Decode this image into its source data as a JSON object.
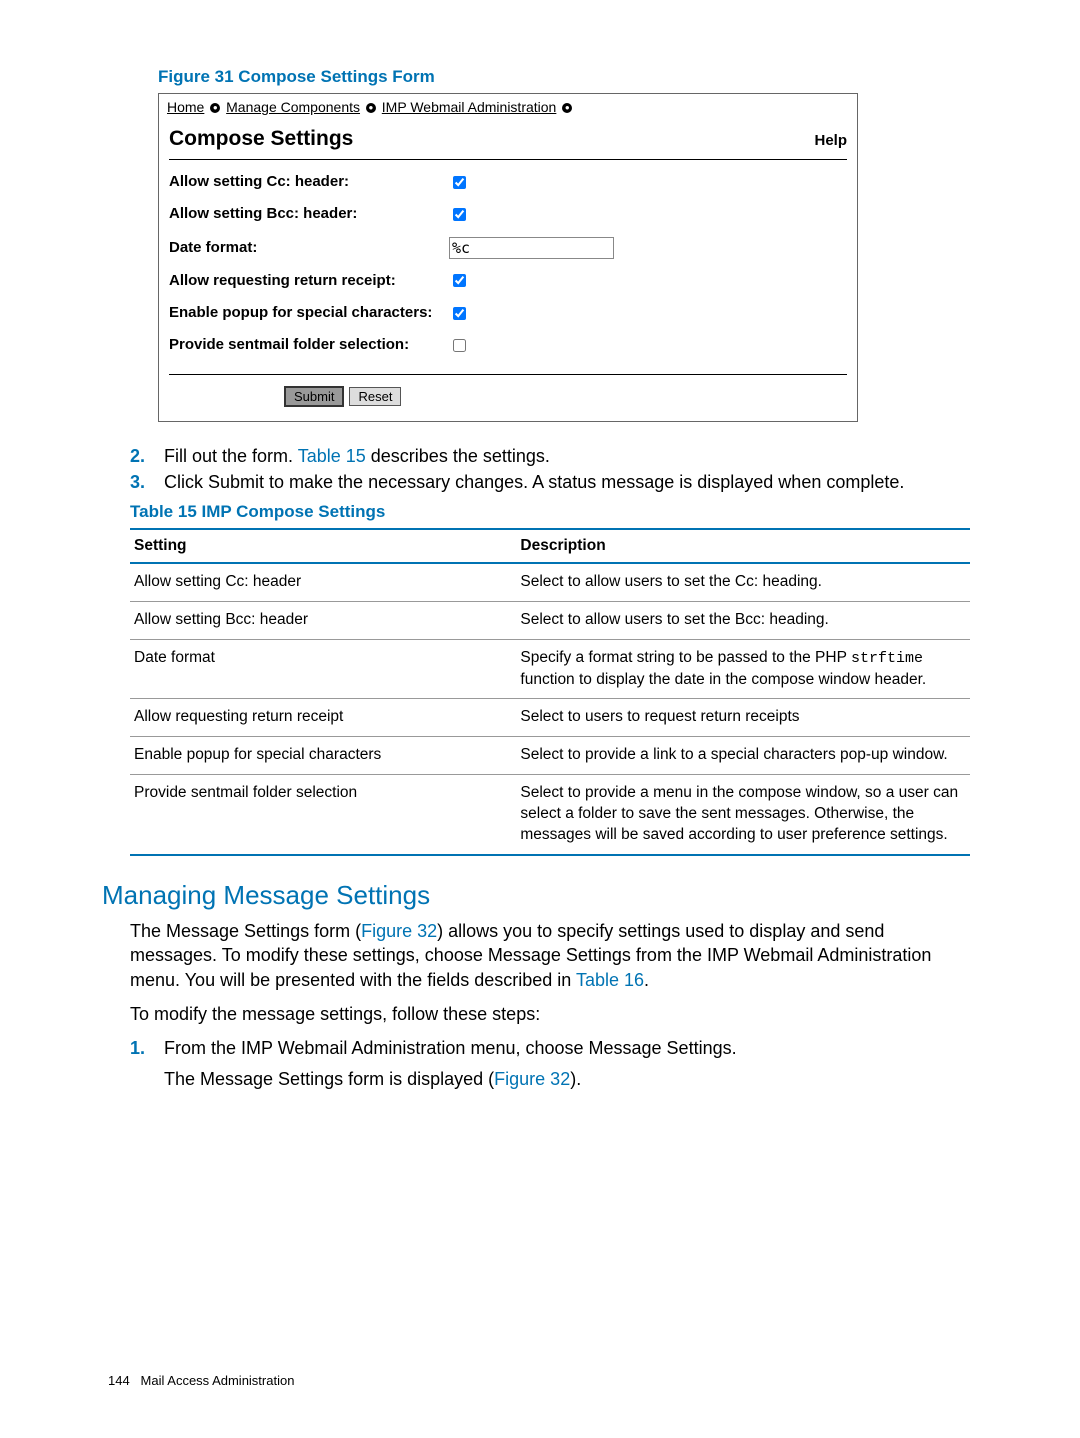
{
  "figure": {
    "caption": "Figure 31 Compose Settings Form",
    "breadcrumb": {
      "home": "Home",
      "manage": "Manage Components",
      "imp": "IMP Webmail Administration"
    },
    "panel_title": "Compose Settings",
    "help": "Help",
    "rows": {
      "cc": {
        "label": "Allow setting Cc: header:",
        "checked": true
      },
      "bcc": {
        "label": "Allow setting Bcc: header:",
        "checked": true
      },
      "date": {
        "label": "Date format:",
        "value": "%c"
      },
      "rr": {
        "label": "Allow requesting return receipt:",
        "checked": true
      },
      "pop": {
        "label": "Enable popup for special characters:",
        "checked": true
      },
      "sent": {
        "label": "Provide sentmail folder selection:",
        "checked": false
      }
    },
    "buttons": {
      "submit": "Submit",
      "reset": "Reset"
    }
  },
  "steps1": [
    {
      "n": "2.",
      "prefix": "Fill out the form. ",
      "link": "Table 15",
      "suffix": " describes the settings."
    },
    {
      "n": "3.",
      "text": "Click Submit to make the necessary changes. A status message is displayed when complete."
    }
  ],
  "table": {
    "caption": "Table 15 IMP Compose Settings",
    "head": {
      "c1": "Setting",
      "c2": "Description"
    },
    "rows": [
      {
        "s": "Allow setting Cc: header",
        "d": "Select to allow users to set the Cc: heading."
      },
      {
        "s": "Allow setting Bcc: header",
        "d": "Select to allow users to set the Bcc: heading."
      },
      {
        "s": "Date format",
        "d_pre": "Specify a format string to be passed to the PHP ",
        "code": "strftime",
        "d_post": " function to display the date in the compose window header."
      },
      {
        "s": "Allow requesting return receipt",
        "d": "Select to users to request return receipts"
      },
      {
        "s": "Enable popup for special characters",
        "d": "Select to provide a link to a special characters pop-up window."
      },
      {
        "s": "Provide sentmail folder selection",
        "d": "Select to provide a menu in the compose window, so a user can select a folder to save the sent messages. Otherwise, the messages will be saved according to user preference settings."
      }
    ]
  },
  "section": {
    "heading": "Managing Message Settings",
    "para1_a": "The Message Settings form (",
    "para1_link1": "Figure 32",
    "para1_b": ") allows you to specify settings used to display and send messages. To modify these settings, choose Message Settings from the IMP Webmail Administration menu. You will be presented with the fields described in ",
    "para1_link2": "Table 16",
    "para1_c": ".",
    "para2": "To modify the message settings, follow these steps:",
    "steps": [
      {
        "n": "1.",
        "line1": "From the IMP Webmail Administration menu, choose Message Settings.",
        "line2_a": "The Message Settings form is displayed (",
        "line2_link": "Figure 32",
        "line2_b": ")."
      }
    ]
  },
  "footer": {
    "page": "144",
    "title": "Mail Access Administration"
  }
}
